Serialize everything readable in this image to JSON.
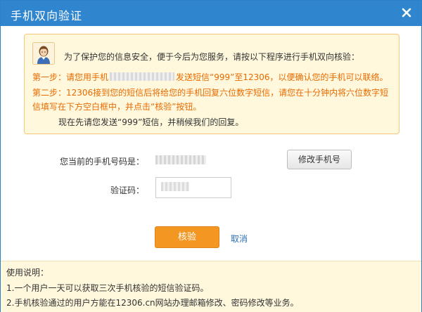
{
  "dialog": {
    "title": "手机双向验证",
    "close_icon": "close-icon"
  },
  "notice": {
    "intro": "为了保护您的信息安全，便于今后为您服务，请按以下程序进行手机双向核验：",
    "step1_prefix": "第一步：请您用手机",
    "step1_suffix": "发送短信“999”至12306，以便确认您的手机可以联络。",
    "step2_line1": "第二步：12306接到您的短信后将给您的手机回复六位数字短信，请您在十分钟内将六位数字短",
    "step2_line2": "信填写在下方空白框中，并点击“核验”按钮。",
    "note": "现在先请您发送“999”短信，并稍候我们的回复。"
  },
  "form": {
    "phone_label": "您当前的手机号码是：",
    "modify_button": "修改手机号",
    "code_label": "验证码：",
    "code_value": ""
  },
  "actions": {
    "verify_button": "核验",
    "cancel_link": "取消"
  },
  "footer": {
    "heading": "使用说明：",
    "item1": "1.一个用户一天可以获取三次手机核验的短信验证码。",
    "item2": "2.手机核验通过的用户方能在12306.cn网站办理邮箱修改、密码修改等业务。"
  },
  "colors": {
    "title_bar": "#2f86cf",
    "notice_bg": "#fff8dd",
    "notice_border": "#f5c77d",
    "primary_button": "#f39622",
    "link": "#2a6fb5",
    "step_text": "#e96a00"
  }
}
